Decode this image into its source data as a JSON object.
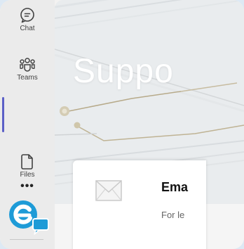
{
  "rail": {
    "items": [
      {
        "label": "Chat",
        "icon": "chat-icon"
      },
      {
        "label": "Teams",
        "icon": "teams-icon"
      },
      {
        "label": "",
        "icon": "support-app-icon"
      },
      {
        "label": "Files",
        "icon": "files-icon"
      },
      {
        "label": "",
        "icon": "more-icon"
      }
    ],
    "more_glyph": "•••"
  },
  "main": {
    "hero_title": "Suppo",
    "card": {
      "title": "Ema",
      "subtitle": "For le",
      "icon": "envelope-icon"
    }
  },
  "colors": {
    "accent": "#5b5fc7",
    "app_icon": "#1e9bd7",
    "rail_bg": "#ebebeb"
  }
}
